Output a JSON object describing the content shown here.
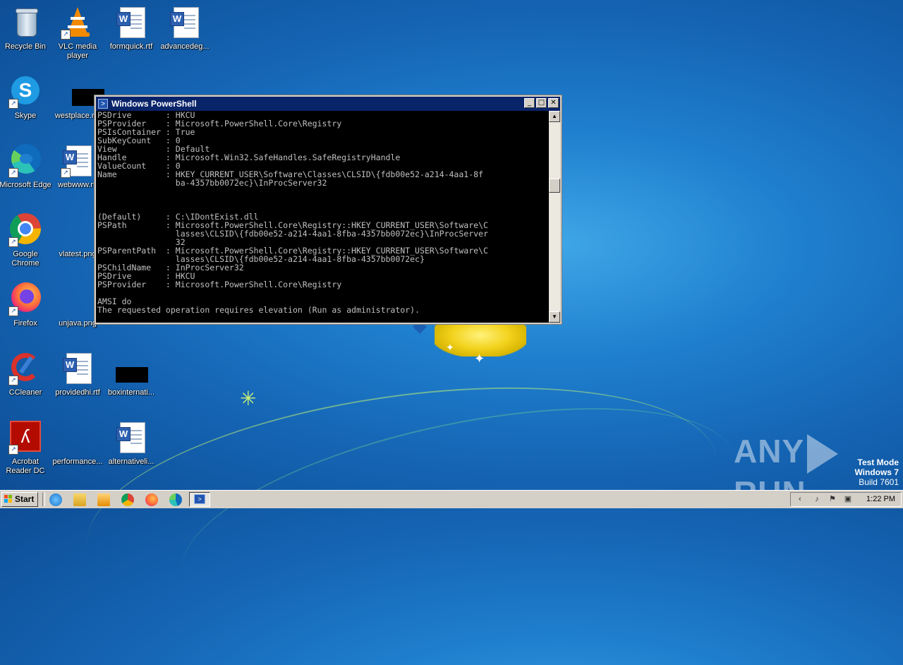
{
  "desktop": {
    "icons": [
      {
        "label": "Recycle Bin"
      },
      {
        "label": "VLC media\nplayer"
      },
      {
        "label": "formquick.rtf"
      },
      {
        "label": "advancedeg..."
      },
      {
        "label": "Skype"
      },
      {
        "label": "westplace.r..."
      },
      {
        "label": "Microsoft Edge"
      },
      {
        "label": "webwww.rtf"
      },
      {
        "label": "Google\nChrome"
      },
      {
        "label": "vlatest.png"
      },
      {
        "label": "Firefox"
      },
      {
        "label": "unjava.png"
      },
      {
        "label": "CCleaner"
      },
      {
        "label": "providedhi.rtf"
      },
      {
        "label": "boxinternati..."
      },
      {
        "label": "Acrobat\nReader DC"
      },
      {
        "label": "performance..."
      },
      {
        "label": "alternativeli..."
      }
    ]
  },
  "window": {
    "title": "Windows PowerShell",
    "buttons": {
      "minimize": "_",
      "maximize": "□",
      "close": "✕"
    },
    "console_text": "PSDrive       : HKCU\nPSProvider    : Microsoft.PowerShell.Core\\Registry\nPSIsContainer : True\nSubKeyCount   : 0\nView          : Default\nHandle        : Microsoft.Win32.SafeHandles.SafeRegistryHandle\nValueCount    : 0\nName          : HKEY_CURRENT_USER\\Software\\Classes\\CLSID\\{fdb00e52-a214-4aa1-8f\n                ba-4357bb0072ec}\\InProcServer32\n\n\n\n(Default)     : C:\\IDontExist.dll\nPSPath        : Microsoft.PowerShell.Core\\Registry::HKEY_CURRENT_USER\\Software\\C\n                lasses\\CLSID\\{fdb00e52-a214-4aa1-8fba-4357bb0072ec}\\InProcServer\n                32\nPSParentPath  : Microsoft.PowerShell.Core\\Registry::HKEY_CURRENT_USER\\Software\\C\n                lasses\\CLSID\\{fdb00e52-a214-4aa1-8fba-4357bb0072ec}\nPSChildName   : InProcServer32\nPSDrive       : HKCU\nPSProvider    : Microsoft.PowerShell.Core\\Registry\n\nAMSI do\nThe requested operation requires elevation (Run as administrator).",
    "scroll_up": "▲",
    "scroll_down": "▼"
  },
  "watermark": {
    "left": "ANY",
    "right": "RUN"
  },
  "test_mode": {
    "line1": "Test Mode",
    "line2": "Windows 7",
    "line3": "Build 7601"
  },
  "taskbar": {
    "start_label": "Start",
    "clock": "1:22 PM"
  }
}
